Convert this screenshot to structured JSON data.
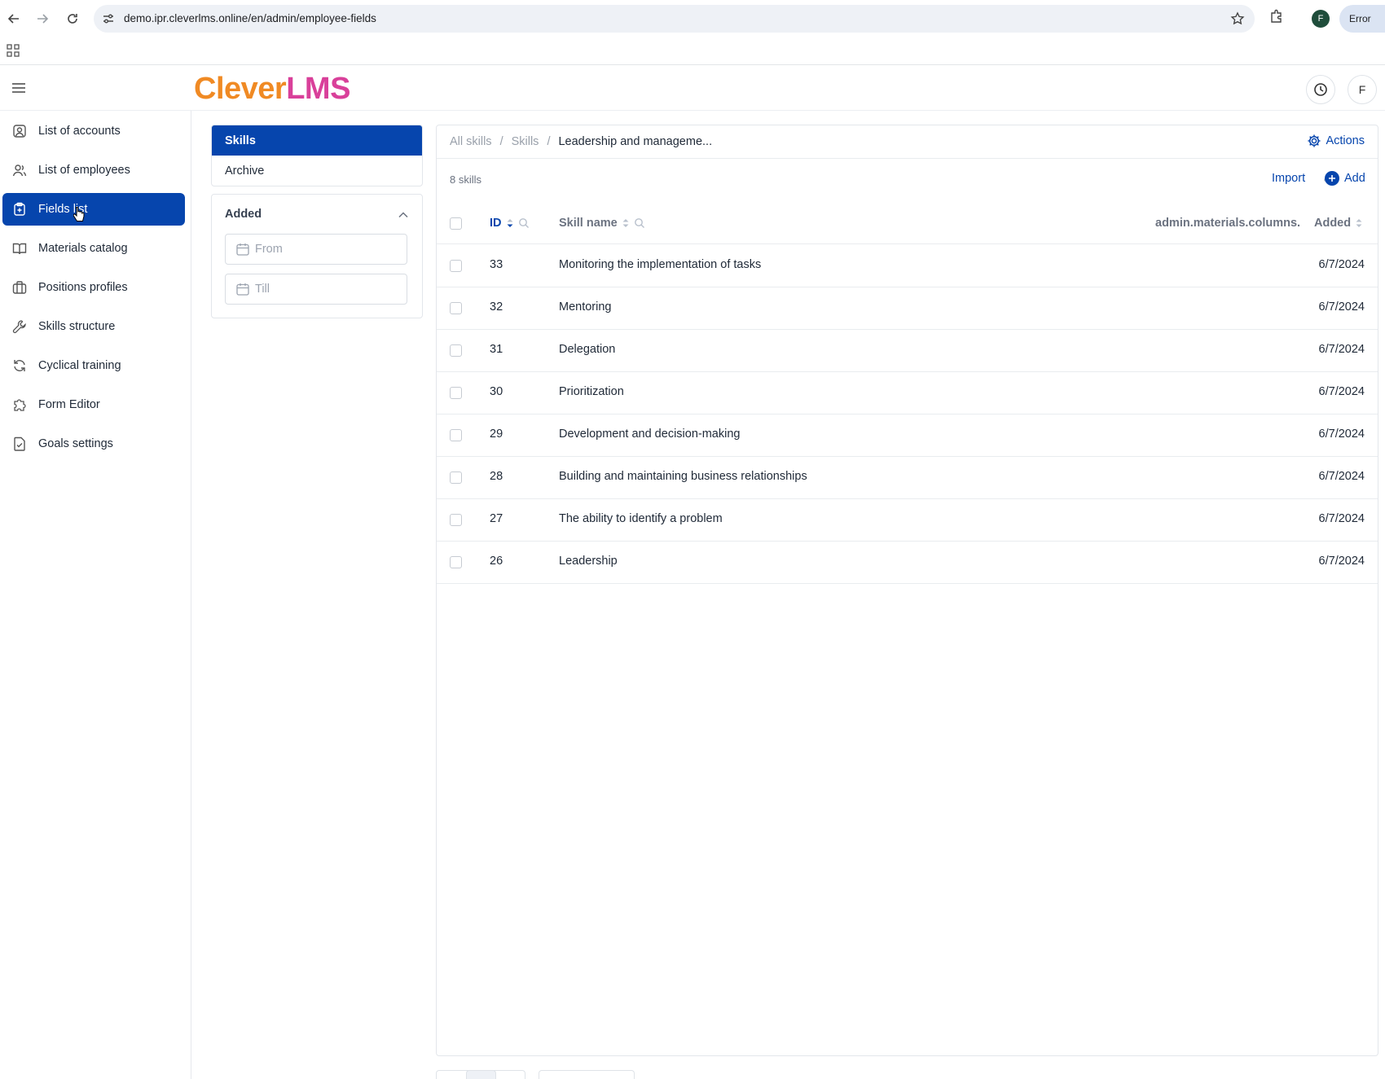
{
  "browser": {
    "url": "demo.ipr.cleverlms.online/en/admin/employee-fields",
    "profile_initial": "F",
    "error_label": "Error"
  },
  "header": {
    "logo_part1": "Clever",
    "logo_part2": "LMS",
    "user_initial": "F"
  },
  "sidebar": {
    "items": [
      {
        "label": "List of accounts",
        "icon": "account-icon"
      },
      {
        "label": "List of employees",
        "icon": "users-icon"
      },
      {
        "label": "Fields list",
        "icon": "clipboard-plus-icon",
        "active": true
      },
      {
        "label": "Materials catalog",
        "icon": "book-icon"
      },
      {
        "label": "Positions profiles",
        "icon": "briefcase-icon"
      },
      {
        "label": "Skills structure",
        "icon": "wrench-icon"
      },
      {
        "label": "Cyclical training",
        "icon": "refresh-icon"
      },
      {
        "label": "Form Editor",
        "icon": "puzzle-icon"
      },
      {
        "label": "Goals settings",
        "icon": "file-check-icon"
      }
    ]
  },
  "tabs": [
    {
      "label": "Skills",
      "active": true
    },
    {
      "label": "Archive",
      "active": false
    }
  ],
  "filter": {
    "title": "Added",
    "from_placeholder": "From",
    "till_placeholder": "Till"
  },
  "breadcrumb": {
    "items": [
      "All skills",
      "Skills"
    ],
    "current": "Leadership and manageme..."
  },
  "toolbar": {
    "actions_label": "Actions",
    "count_text": "8 skills",
    "import_label": "Import",
    "add_label": "Add"
  },
  "table": {
    "columns": [
      "ID",
      "Skill name",
      "admin.materials.columns.",
      "Added"
    ],
    "rows": [
      {
        "id": "33",
        "name": "Monitoring the implementation of tasks",
        "added": "6/7/2024"
      },
      {
        "id": "32",
        "name": "Mentoring",
        "added": "6/7/2024"
      },
      {
        "id": "31",
        "name": "Delegation",
        "added": "6/7/2024"
      },
      {
        "id": "30",
        "name": "Prioritization",
        "added": "6/7/2024"
      },
      {
        "id": "29",
        "name": "Development and decision-making",
        "added": "6/7/2024"
      },
      {
        "id": "28",
        "name": "Building and maintaining business relationships",
        "added": "6/7/2024"
      },
      {
        "id": "27",
        "name": "The ability to identify a problem",
        "added": "6/7/2024"
      },
      {
        "id": "26",
        "name": "Leadership",
        "added": "6/7/2024"
      }
    ]
  },
  "colors": {
    "primary": "#0645ad",
    "logo_orange": "#f08a24",
    "logo_pink": "#d9409a"
  }
}
